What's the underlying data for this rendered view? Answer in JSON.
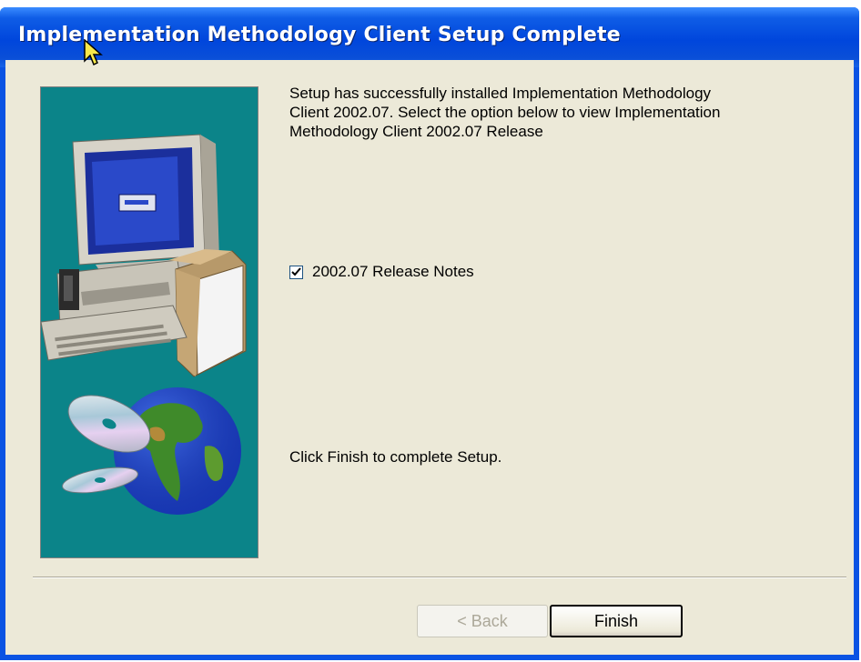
{
  "window": {
    "title": "Implementation Methodology Client Setup Complete"
  },
  "main": {
    "message": "Setup has successfully installed Implementation Methodology\nClient 2002.07. Select the option below to view Implementation\nMethodology Client 2002.07 Release",
    "checkbox": {
      "label": "2002.07 Release Notes",
      "checked": true
    },
    "finish_message": "Click Finish to complete Setup."
  },
  "buttons": {
    "back_label": "< Back",
    "finish_label": "Finish"
  },
  "colors": {
    "titlebar": "#0046dc",
    "client_bg": "#ece9d8",
    "bitmap_bg": "#0b8489"
  },
  "icons": {
    "bitmap": "computer-with-cds-and-globe",
    "cursor": "arrow-cursor"
  }
}
